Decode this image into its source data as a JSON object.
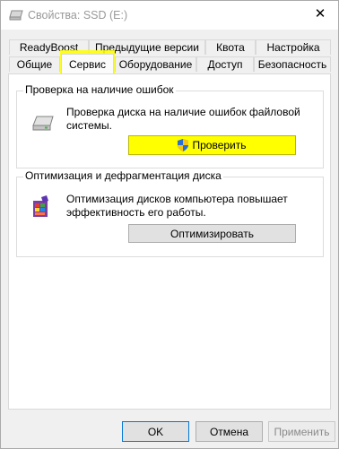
{
  "window": {
    "title": "Свойства: SSD (E:)",
    "close_glyph": "✕"
  },
  "tabs_top": [
    {
      "label": "ReadyBoost"
    },
    {
      "label": "Предыдущие версии"
    },
    {
      "label": "Квота"
    },
    {
      "label": "Настройка"
    }
  ],
  "tabs_bottom": [
    {
      "label": "Общие"
    },
    {
      "label": "Сервис",
      "active": true
    },
    {
      "label": "Оборудование"
    },
    {
      "label": "Доступ"
    },
    {
      "label": "Безопасность"
    }
  ],
  "error_check": {
    "title": "Проверка на наличие ошибок",
    "description_line1": "Проверка диска на наличие ошибок файловой",
    "description_line2": "системы.",
    "button_label": "Проверить"
  },
  "optimize": {
    "title": "Оптимизация и дефрагментация диска",
    "description_line1": "Оптимизация дисков компьютера повышает",
    "description_line2": "эффективность его работы.",
    "button_label": "Оптимизировать"
  },
  "footer": {
    "ok": "OK",
    "cancel": "Отмена",
    "apply": "Применить"
  },
  "colors": {
    "highlight": "#ffff00",
    "accent": "#0078d7"
  },
  "icons": {
    "title": "drive-icon",
    "error_check": "drive-check-icon",
    "shield": "shield-icon",
    "defrag": "defrag-icon"
  }
}
